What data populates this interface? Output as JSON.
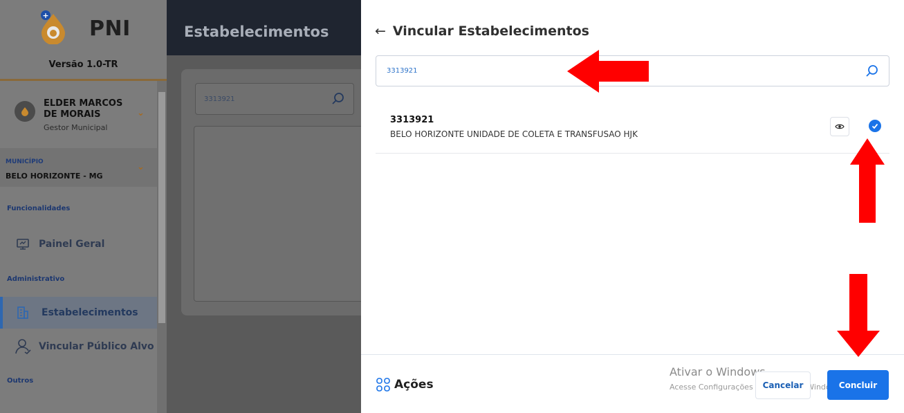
{
  "app": {
    "name": "PNI",
    "version": "Versão 1.0-TR"
  },
  "user": {
    "name": "ELDER MARCOS DE MORAIS",
    "role": "Gestor Municipal"
  },
  "municipality": {
    "label": "MUNICÍPIO",
    "value": "BELO HORIZONTE - MG"
  },
  "sidebar": {
    "sections": {
      "functionalities": "Funcionalidades",
      "administrative": "Administrativo",
      "others": "Outros"
    },
    "items": [
      {
        "label": "Painel Geral",
        "icon": "monitor-icon"
      },
      {
        "label": "Estabelecimentos",
        "icon": "building-icon",
        "active": true
      },
      {
        "label": "Vincular Público Alvo",
        "icon": "user-icon"
      }
    ]
  },
  "page": {
    "title": "Estabelecimentos",
    "search_value": "3313921"
  },
  "drawer": {
    "title": "Vincular Estabelecimentos",
    "search_value": "3313921",
    "results": [
      {
        "code": "3313921",
        "name": "BELO HORIZONTE UNIDADE DE COLETA E TRANSFUSAO HJK",
        "checked": true
      }
    ],
    "footer": {
      "actions_label": "Ações",
      "cancel_label": "Cancelar",
      "confirm_label": "Concluir"
    }
  },
  "windows_watermark": {
    "title": "Ativar o Windows",
    "subtitle": "Acesse Configurações para ativar o Windows."
  },
  "colors": {
    "primary": "#1a73e8",
    "annotation": "#ff0000",
    "topbar": "#1f2530"
  }
}
